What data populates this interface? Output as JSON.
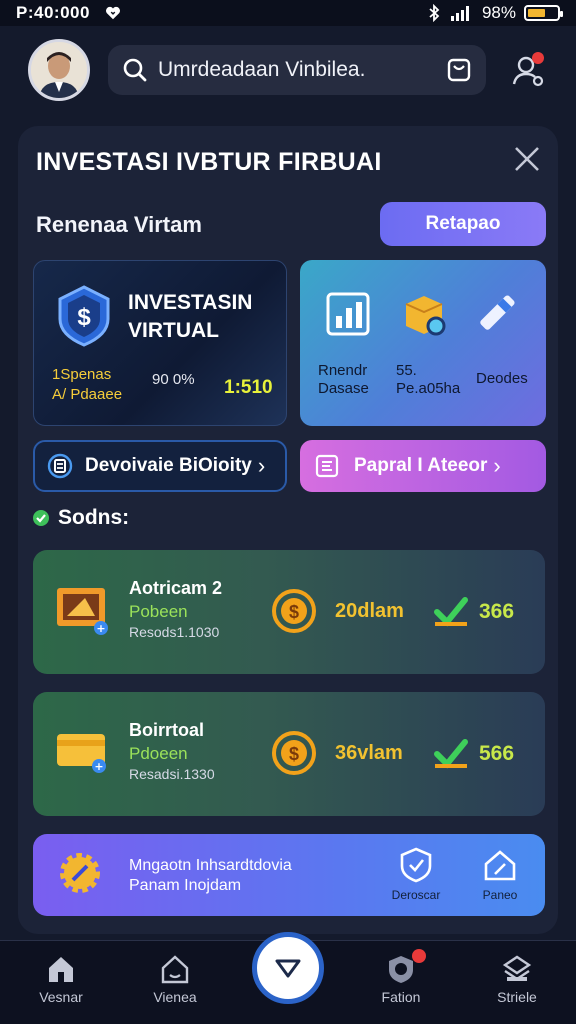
{
  "status_bar": {
    "time": "P:40:000",
    "battery": "98%",
    "battery_level": 0.6
  },
  "header": {
    "search_text": "Umrdeadaan Vinbilea."
  },
  "panel": {
    "title": "INVESTASI IVBTUR FIRBUAI",
    "subtitle": "Renenaa Virtam",
    "top_button": "Retapao",
    "invest_card": {
      "title": "INVESTASIN VIRTUAL",
      "label_a1": "1Spenas",
      "label_a2": "A/ Pdaaee",
      "label_b": "90 0%",
      "label_c": "1:510"
    },
    "tools": [
      {
        "label": "Rnendr Dasase",
        "icon": "chart-icon"
      },
      {
        "label": "55. Pe.a05ha",
        "icon": "box-search-icon"
      },
      {
        "label": "Deodes",
        "icon": "pen-icon"
      }
    ],
    "dev_button": "Devoivaie BiOioity",
    "prop_button": "Papral I Ateeor",
    "status_heading": "Sodns:",
    "rows": [
      {
        "name": "Aotricam 2",
        "sub": "Pobeen",
        "meta": "Resods1.1030",
        "amount": "20dlam",
        "value": "366"
      },
      {
        "name": "Boirrtoal",
        "sub": "Pdoeen",
        "meta": "Resadsi.1330",
        "amount": "36vlam",
        "value": "566"
      }
    ],
    "promo": {
      "line1": "Mngaotn Inhsardtdovia",
      "line2": "Panam Inojdam",
      "action1": "Deroscar",
      "action2": "Paneo"
    }
  },
  "bottom_nav": [
    {
      "label": "Vesnar",
      "icon": "home-icon"
    },
    {
      "label": "Vienea",
      "icon": "house-outline-icon"
    },
    {
      "label": "",
      "icon": "triangle-down-icon"
    },
    {
      "label": "Fation",
      "icon": "shield-badge-icon"
    },
    {
      "label": "Striele",
      "icon": "layers-icon"
    }
  ]
}
